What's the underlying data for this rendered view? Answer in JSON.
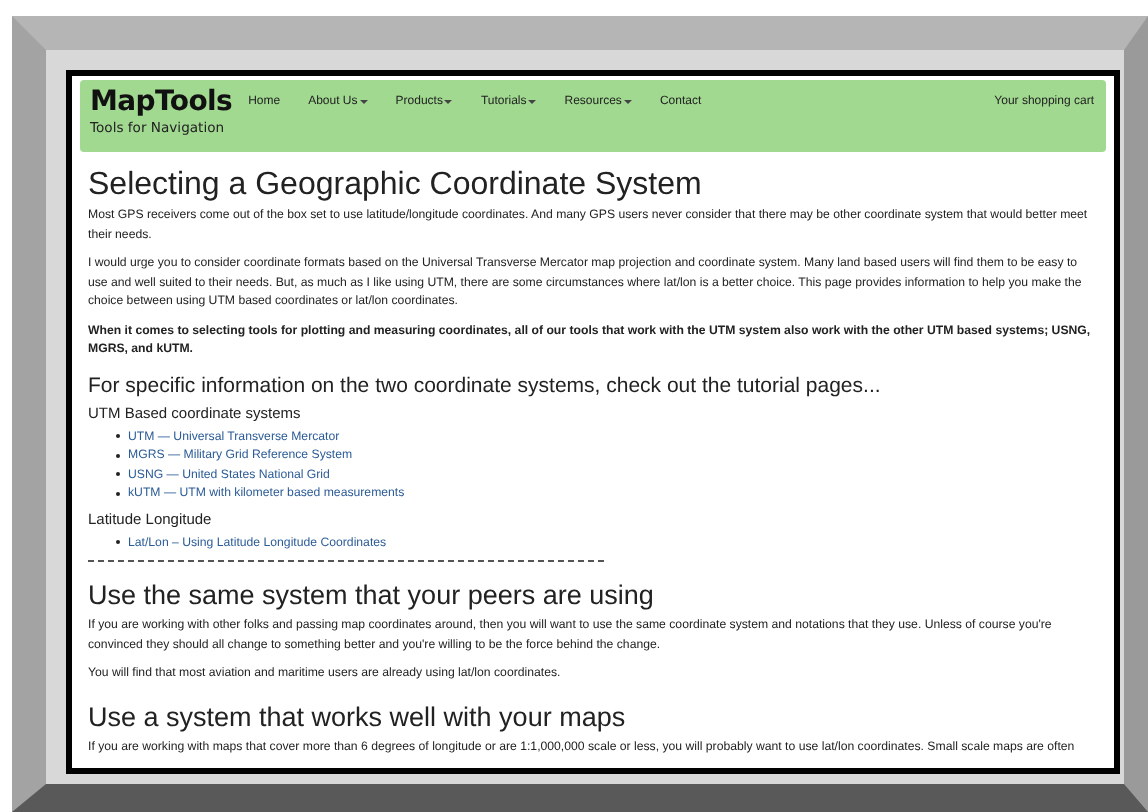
{
  "logo": {
    "title": "MapTools",
    "tagline": "Tools for Navigation"
  },
  "nav": {
    "items": [
      {
        "label": "Home",
        "dropdown": false
      },
      {
        "label": "About Us",
        "dropdown": true
      },
      {
        "label": "Products",
        "dropdown": true
      },
      {
        "label": "Tutorials",
        "dropdown": true
      },
      {
        "label": "Resources",
        "dropdown": true
      },
      {
        "label": "Contact",
        "dropdown": false
      }
    ],
    "cart": "Your shopping cart"
  },
  "content": [
    {
      "kind": "h1",
      "text": "Selecting a Geographic Coordinate System"
    },
    {
      "kind": "p",
      "text": "Most GPS receivers come out of the box set to use latitude/longitude coordinates. And many GPS users never consider that there may be other coordinate system that would better meet their needs."
    },
    {
      "kind": "p",
      "text": "I would urge you to consider coordinate formats based on the Universal Transverse Mercator map projection and coordinate system. Many land based users will find them to be easy to use and well suited to their needs. But, as much as I like using UTM, there are some circumstances where lat/lon is a better choice. This page provides information to help you make the choice between using UTM based coordinates or lat/lon coordinates."
    },
    {
      "kind": "strong",
      "text": "When it comes to selecting tools for plotting and measuring coordinates, all of our tools that work with the UTM system also work with the other UTM based systems; USNG, MGRS, and kUTM."
    },
    {
      "kind": "h3",
      "text": "For specific information on the two coordinate systems, check out the tutorial pages..."
    },
    {
      "kind": "h4",
      "text": "UTM Based coordinate systems"
    },
    {
      "kind": "links",
      "items": [
        "UTM — Universal Transverse Mercator",
        "MGRS — Military Grid Reference System",
        "USNG — United States National Grid",
        "kUTM — UTM with kilometer based measurements"
      ]
    },
    {
      "kind": "h4",
      "text": "Latitude Longitude"
    },
    {
      "kind": "links",
      "items": [
        "Lat/Lon – Using Latitude Longitude Coordinates"
      ]
    },
    {
      "kind": "rule"
    },
    {
      "kind": "h2",
      "text": "Use the same system that your peers are using"
    },
    {
      "kind": "p",
      "text": "If you are working with other folks and passing map coordinates around, then you will want to use the same coordinate system and notations that they use. Unless of course you're convinced they should all change to something better and you're willing to be the force behind the change."
    },
    {
      "kind": "p",
      "text": "You will find that most aviation and maritime users are already using lat/lon coordinates."
    },
    {
      "kind": "h2",
      "text": "Use a system that works well with your maps"
    },
    {
      "kind": "p",
      "text": "If you are working with maps that cover more than 6 degrees of longitude or are 1:1,000,000 scale or less, you will probably want to use lat/lon coordinates. Small scale maps are often"
    }
  ]
}
